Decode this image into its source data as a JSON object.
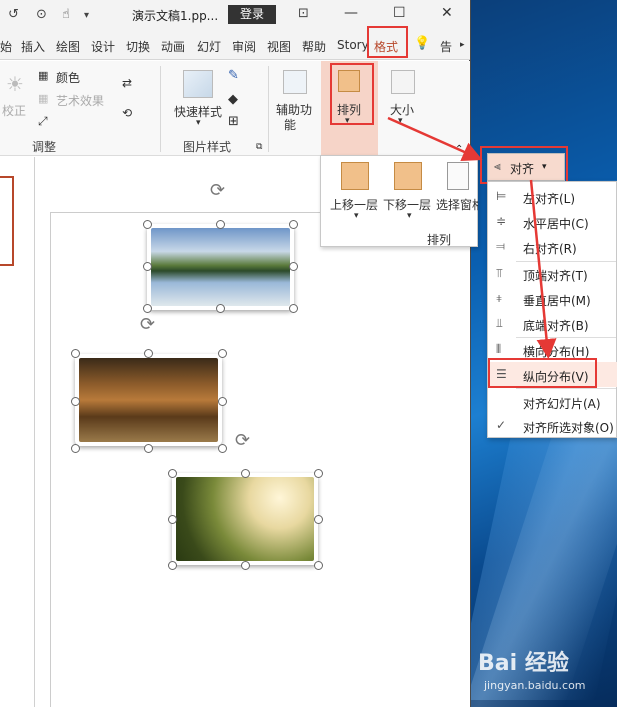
{
  "titlebar": {
    "doc_title": "演示文稿1.pp...",
    "login": "登录",
    "minimize": "—",
    "maximize": "☐"
  },
  "tabs": [
    {
      "label": "始"
    },
    {
      "label": "插入"
    },
    {
      "label": "绘图"
    },
    {
      "label": "设计"
    },
    {
      "label": "切换"
    },
    {
      "label": "动画"
    },
    {
      "label": "幻灯"
    },
    {
      "label": "审阅"
    },
    {
      "label": "视图"
    },
    {
      "label": "帮助"
    },
    {
      "label": "Story"
    },
    {
      "label": "格式"
    },
    {
      "label": "告"
    }
  ],
  "ribbon": {
    "correct": "校正",
    "color": "颜色",
    "art_effect": "艺术效果",
    "adjust_group": "调整",
    "quick_style": "快速样式",
    "picture_style_group": "图片样式",
    "accessibility_line1": "辅助功",
    "accessibility_line2": "能",
    "arrange": "排列",
    "size": "大小"
  },
  "arrange_popup": {
    "bring_forward": "上移一层",
    "send_backward": "下移一层",
    "selection_pane": "选择窗格",
    "group_label": "排列"
  },
  "align_button": "对齐",
  "align_menu": [
    {
      "label": "左对齐(L)",
      "icon": "align-left-icon"
    },
    {
      "label": "水平居中(C)",
      "icon": "align-center-icon"
    },
    {
      "label": "右对齐(R)",
      "icon": "align-right-icon"
    },
    {
      "label": "顶端对齐(T)",
      "icon": "align-top-icon"
    },
    {
      "label": "垂直居中(M)",
      "icon": "align-middle-icon"
    },
    {
      "label": "底端对齐(B)",
      "icon": "align-bottom-icon"
    },
    {
      "label": "横向分布(H)",
      "icon": "distribute-horizontal-icon"
    },
    {
      "label": "纵向分布(V)",
      "icon": "distribute-vertical-icon"
    },
    {
      "label": "对齐幻灯片(A)",
      "icon": ""
    },
    {
      "label": "对齐所选对象(O)",
      "icon": "check-icon"
    }
  ],
  "watermark": {
    "brand": "Bai 经验",
    "url": "jingyan.baidu.com"
  },
  "colors": {
    "accent": "#b7472a",
    "highlight_red": "#e53935",
    "arrange_bg": "#f6d4c8"
  }
}
